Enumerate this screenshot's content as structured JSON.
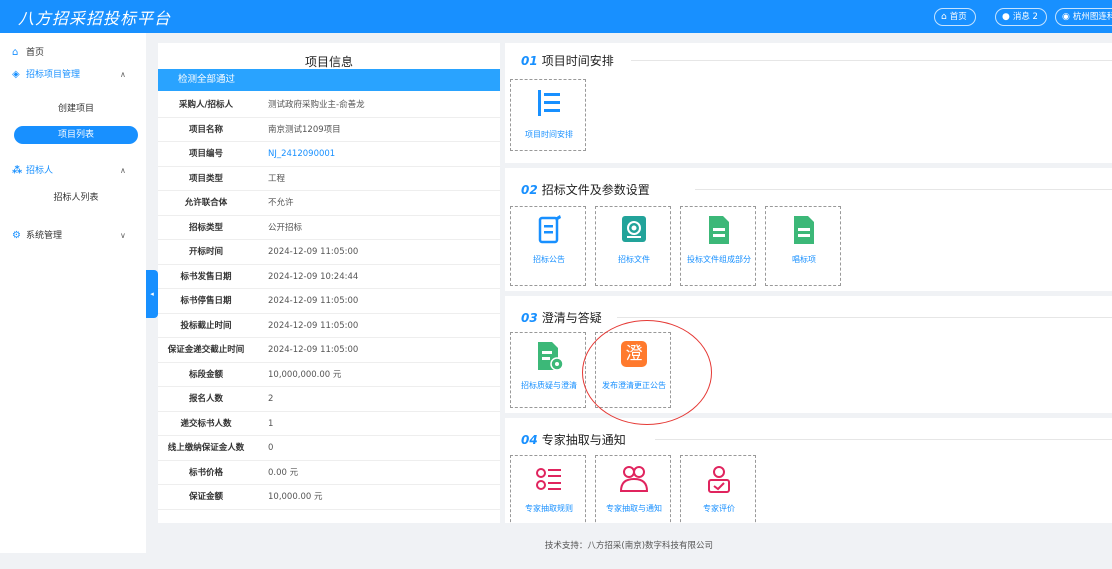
{
  "topbar": {
    "logo": "八方招采招投标平台",
    "home": "首页",
    "messages": "消息 2",
    "user": "杭州图连科"
  },
  "sidebar": {
    "home": "首页",
    "bid_mgmt": "招标项目管理",
    "create_project": "创建项目",
    "project_list": "项目列表",
    "tenderer": "招标人",
    "tenderer_list": "招标人列表",
    "system": "系统管理"
  },
  "info": {
    "title": "项目信息",
    "status": "检测全部通过",
    "rows": [
      {
        "k": "采购人/招标人",
        "v": "测试政府采购业主-俞善龙"
      },
      {
        "k": "项目名称",
        "v": "南京测试1209项目"
      },
      {
        "k": "项目编号",
        "v": "NJ_2412090001"
      },
      {
        "k": "项目类型",
        "v": "工程"
      },
      {
        "k": "允许联合体",
        "v": "不允许"
      },
      {
        "k": "招标类型",
        "v": "公开招标"
      },
      {
        "k": "开标时间",
        "v": "2024-12-09 11:05:00"
      },
      {
        "k": "标书发售日期",
        "v": "2024-12-09 10:24:44"
      },
      {
        "k": "标书停售日期",
        "v": "2024-12-09 11:05:00"
      },
      {
        "k": "投标截止时间",
        "v": "2024-12-09 11:05:00"
      },
      {
        "k": "保证金递交截止时间",
        "v": "2024-12-09 11:05:00"
      },
      {
        "k": "标段金额",
        "v": "10,000,000.00 元"
      },
      {
        "k": "报名人数",
        "v": "2"
      },
      {
        "k": "递交标书人数",
        "v": "1"
      },
      {
        "k": "线上缴纳保证金人数",
        "v": "0"
      },
      {
        "k": "标书价格",
        "v": "0.00 元"
      },
      {
        "k": "保证金额",
        "v": "10,000.00 元"
      }
    ]
  },
  "sections": {
    "s1": {
      "num": "01",
      "title": "项目时间安排",
      "cards": [
        "项目时间安排"
      ]
    },
    "s2": {
      "num": "02",
      "title": "招标文件及参数设置",
      "cards": [
        "招标公告",
        "招标文件",
        "投标文件组成部分",
        "唱标项"
      ]
    },
    "s3": {
      "num": "03",
      "title": "澄清与答疑",
      "cards": [
        "招标质疑与澄清",
        "发布澄清更正公告"
      ],
      "clarify_char": "澄"
    },
    "s4": {
      "num": "04",
      "title": "专家抽取与通知",
      "cards": [
        "专家抽取规则",
        "专家抽取与通知",
        "专家评价"
      ]
    }
  },
  "footer": "技术支持：八方招采(南京)数字科技有限公司",
  "colors": {
    "accent": "#1890ff",
    "green": "#3cb878",
    "orange": "#ff7a2d",
    "pink": "#e0245e",
    "highlight": "#e53935"
  }
}
